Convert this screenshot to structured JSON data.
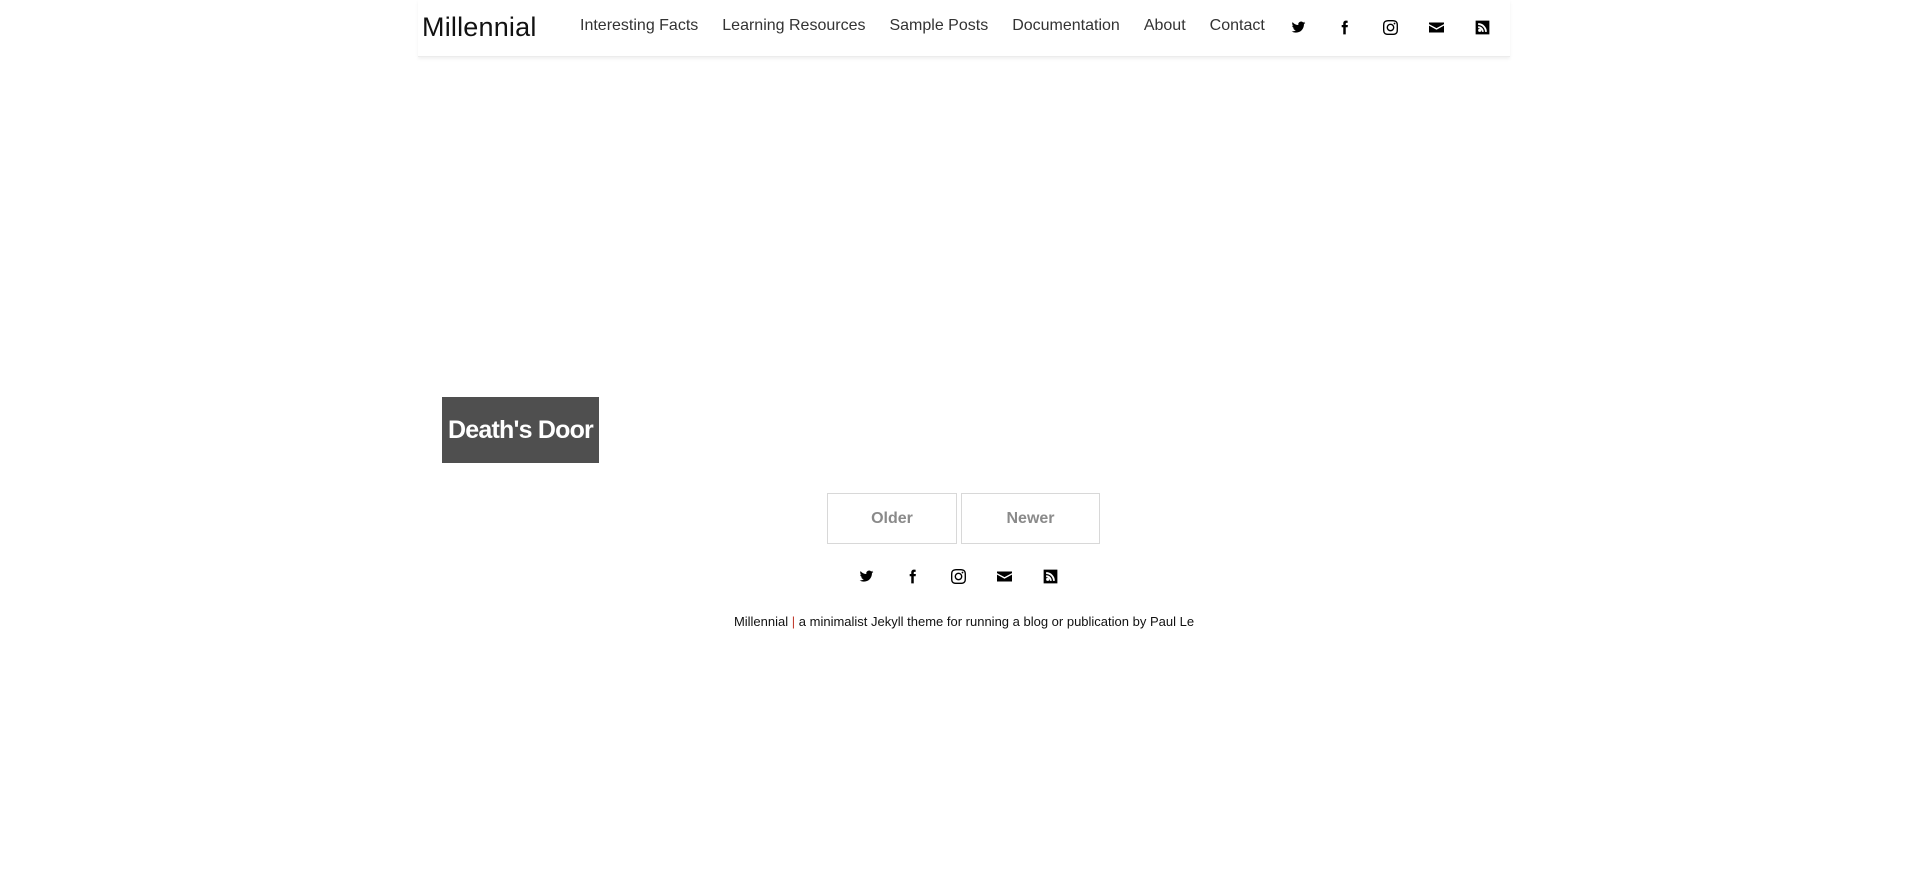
{
  "header": {
    "brand": "Millennial",
    "nav": [
      {
        "label": "Interesting Facts"
      },
      {
        "label": "Learning Resources"
      },
      {
        "label": "Sample Posts"
      },
      {
        "label": "Documentation"
      },
      {
        "label": "About"
      },
      {
        "label": "Contact"
      }
    ],
    "social_icons": [
      "twitter-icon",
      "facebook-icon",
      "instagram-icon",
      "envelope-icon",
      "rss-icon"
    ]
  },
  "post": {
    "title": "Death's Door",
    "card_color": "#4f4f4f"
  },
  "pagination": {
    "older_label": "Older",
    "newer_label": "Newer"
  },
  "footer": {
    "social_icons": [
      "twitter-icon",
      "facebook-icon",
      "instagram-icon",
      "envelope-icon",
      "rss-icon"
    ],
    "site_name": "Millennial",
    "separator": "|",
    "tagline": "a minimalist Jekyll theme for running a blog or publication by",
    "author": "Paul Le"
  }
}
